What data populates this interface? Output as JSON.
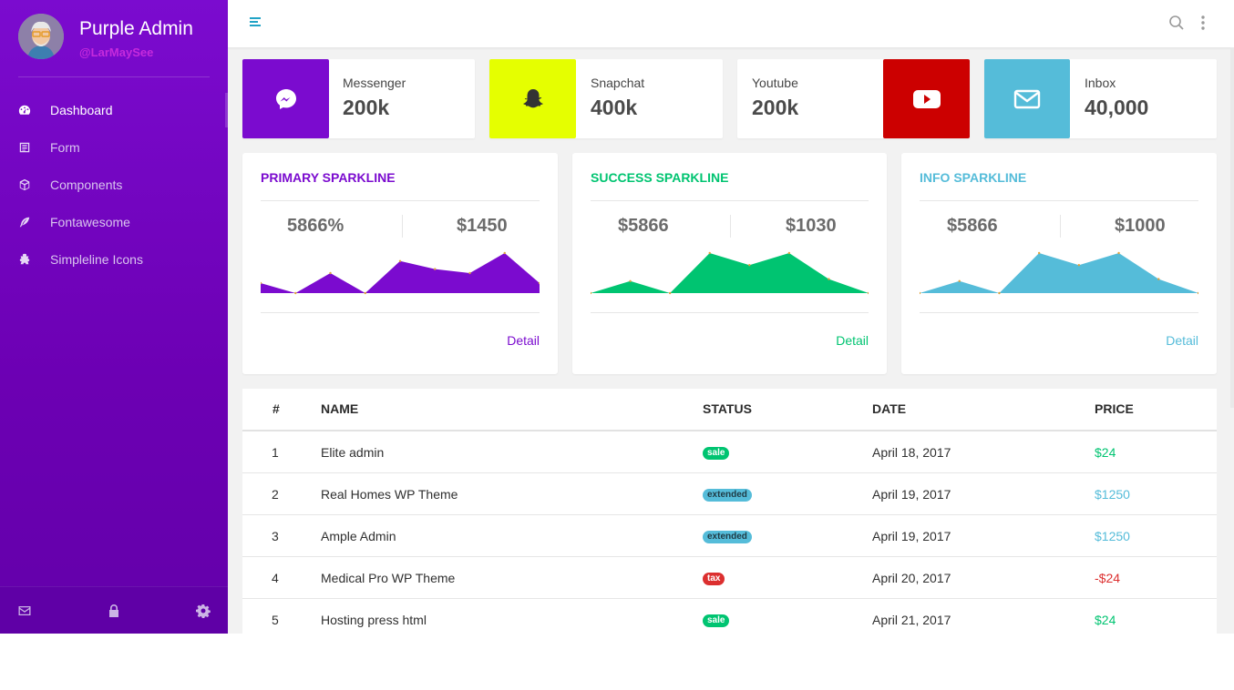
{
  "profile": {
    "name": "Purple Admin",
    "handle": "@LarMaySee"
  },
  "sidebar": {
    "items": [
      {
        "label": "Dashboard",
        "icon": "dashboard-icon",
        "active": true
      },
      {
        "label": "Form",
        "icon": "form-icon",
        "active": false
      },
      {
        "label": "Components",
        "icon": "cube-icon",
        "active": false
      },
      {
        "label": "Fontawesome",
        "icon": "feather-icon",
        "active": false
      },
      {
        "label": "Simpleline Icons",
        "icon": "puzzle-icon",
        "active": false
      }
    ],
    "footer_icons": [
      "mail-icon",
      "lock-icon",
      "gear-icon"
    ]
  },
  "topbar": {
    "icons": [
      "menu-icon",
      "search-icon",
      "more-vertical-icon"
    ]
  },
  "social": [
    {
      "label": "Messenger",
      "value": "200k",
      "color": "#7b0bcf",
      "icon": "messenger-icon"
    },
    {
      "label": "Snapchat",
      "value": "400k",
      "color": "#e5ff00",
      "icon": "snapchat-icon"
    },
    {
      "label": "Youtube",
      "value": "200k",
      "color": "#cc0000",
      "icon": "youtube-icon"
    },
    {
      "label": "Inbox",
      "value": "40,000",
      "color": "#55bcd9",
      "icon": "mail-icon"
    }
  ],
  "sparklines": [
    {
      "title": "PRIMARY SPARKLINE",
      "stat_left": "5866%",
      "stat_right": "$1450",
      "detail": "Detail",
      "color": "#7b0bcf",
      "points": [
        5,
        0,
        10,
        0,
        16,
        12,
        10,
        20,
        5
      ]
    },
    {
      "title": "SUCCESS SPARKLINE",
      "stat_left": "$5866",
      "stat_right": "$1030",
      "detail": "Detail",
      "color": "#00c471",
      "points": [
        0,
        6,
        0,
        20,
        14,
        20,
        7,
        0
      ]
    },
    {
      "title": "INFO SPARKLINE",
      "stat_left": "$5866",
      "stat_right": "$1000",
      "detail": "Detail",
      "color": "#55bcd9",
      "points": [
        0,
        6,
        0,
        20,
        14,
        20,
        7,
        0
      ]
    }
  ],
  "table": {
    "headers": [
      "#",
      "NAME",
      "STATUS",
      "DATE",
      "PRICE"
    ],
    "rows": [
      {
        "num": "1",
        "name": "Elite admin",
        "status": "sale",
        "status_color": "#00c471",
        "date": "April 18, 2017",
        "price": "$24",
        "price_color": "#00c471"
      },
      {
        "num": "2",
        "name": "Real Homes WP Theme",
        "status": "extended",
        "status_color": "#55bcd9",
        "date": "April 19, 2017",
        "price": "$1250",
        "price_color": "#55bcd9"
      },
      {
        "num": "3",
        "name": "Ample Admin",
        "status": "extended",
        "status_color": "#55bcd9",
        "date": "April 19, 2017",
        "price": "$1250",
        "price_color": "#55bcd9"
      },
      {
        "num": "4",
        "name": "Medical Pro WP Theme",
        "status": "tax",
        "status_color": "#dc2f2f",
        "date": "April 20, 2017",
        "price": "-$24",
        "price_color": "#dc2f2f"
      },
      {
        "num": "5",
        "name": "Hosting press html",
        "status": "sale",
        "status_color": "#00c471",
        "date": "April 21, 2017",
        "price": "$24",
        "price_color": "#00c471"
      }
    ]
  }
}
